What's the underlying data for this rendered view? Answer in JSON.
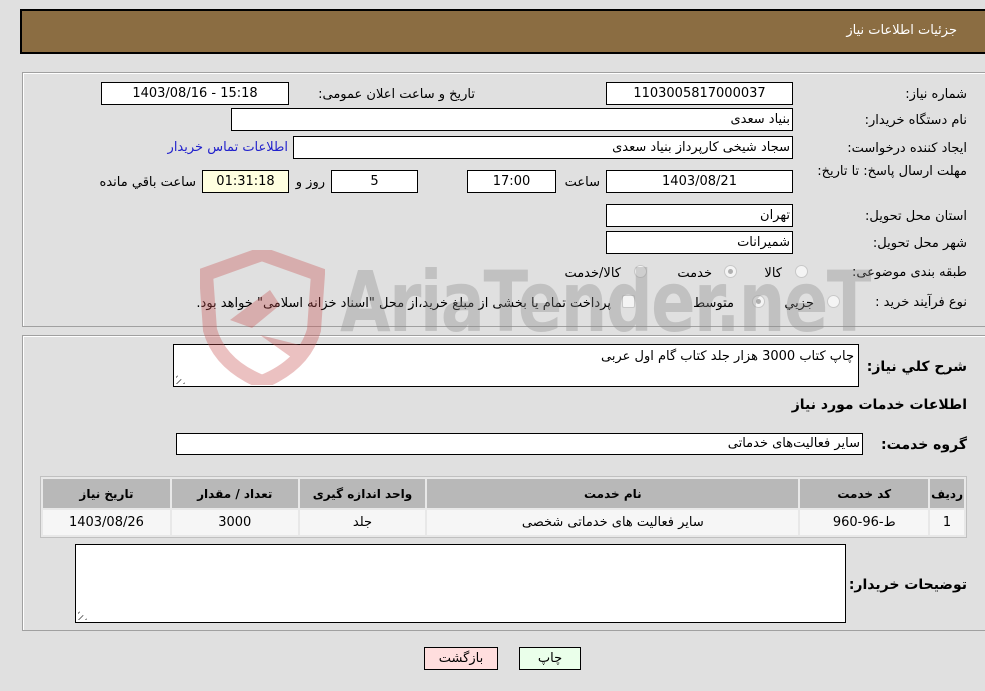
{
  "header": {
    "title": "جزئیات اطلاعات نیاز"
  },
  "fields": {
    "need_number_label": "شماره نیاز:",
    "need_number": "1103005817000037",
    "announce_label": "تاریخ و ساعت اعلان عمومی:",
    "announce_value": "1403/08/16 - 15:18",
    "buyer_org_label": "نام دستگاه خریدار:",
    "buyer_org": "بنیاد سعدی",
    "creator_label": "ایجاد کننده درخواست:",
    "creator": "سجاد شیخی کارپرداز بنیاد سعدی",
    "contact_link": "اطلاعات تماس خریدار",
    "deadline_label": "مهلت ارسال پاسخ: تا تاریخ:",
    "deadline_date": "1403/08/21",
    "time_label": "ساعت",
    "deadline_time": "17:00",
    "days_value": "5",
    "days_label": "روز و",
    "remaining_time": "01:31:18",
    "remaining_label": "ساعت باقي مانده",
    "province_label": "استان محل تحویل:",
    "province": "تهران",
    "city_label": "شهر محل تحویل:",
    "city": "شمیرانات",
    "category_label": "طبقه بندی موضوعی:",
    "category_options": [
      {
        "label": "کالا",
        "checked": false
      },
      {
        "label": "خدمت",
        "checked": true
      },
      {
        "label": "کالا/خدمت",
        "checked": false
      }
    ],
    "process_label": "نوع فرآیند خرید :",
    "process_options": [
      {
        "label": "جزیي",
        "checked": false
      },
      {
        "label": "متوسط",
        "checked": true
      }
    ],
    "treasury_note": "پرداخت تمام یا بخشی از مبلغ خرید،از محل \"اسناد خزانه اسلامی\" خواهد بود.",
    "treasury_checked": false
  },
  "description": {
    "label": "شرح کلي نیاز:",
    "value": "چاپ کتاب 3000 هزار جلد کتاب گام اول عربی"
  },
  "services": {
    "section_title": "اطلاعات خدمات مورد نیاز",
    "group_label": "گروه خدمت:",
    "group_value": "سایر فعالیت‌های خدماتی",
    "columns": [
      "ردیف",
      "کد خدمت",
      "نام خدمت",
      "واحد اندازه گیری",
      "تعداد / مقدار",
      "تاریخ نیاز"
    ],
    "rows": [
      {
        "index": "1",
        "code": "ط-96-960",
        "name": "سایر فعالیت های خدماتی شخصی",
        "unit": "جلد",
        "quantity": "3000",
        "date": "1403/08/26"
      }
    ]
  },
  "buyer_notes": {
    "label": "توضیحات خریدار:",
    "value": ""
  },
  "buttons": {
    "print": "چاپ",
    "back": "بازگشت"
  },
  "watermark": {
    "text": "AriaTender.neT"
  },
  "colors": {
    "header_bg": "#8b6d42",
    "link": "#2222cc",
    "back_btn": "#ffdede",
    "print_btn": "#eaffea",
    "remaining_bg": "#ffffe0"
  }
}
